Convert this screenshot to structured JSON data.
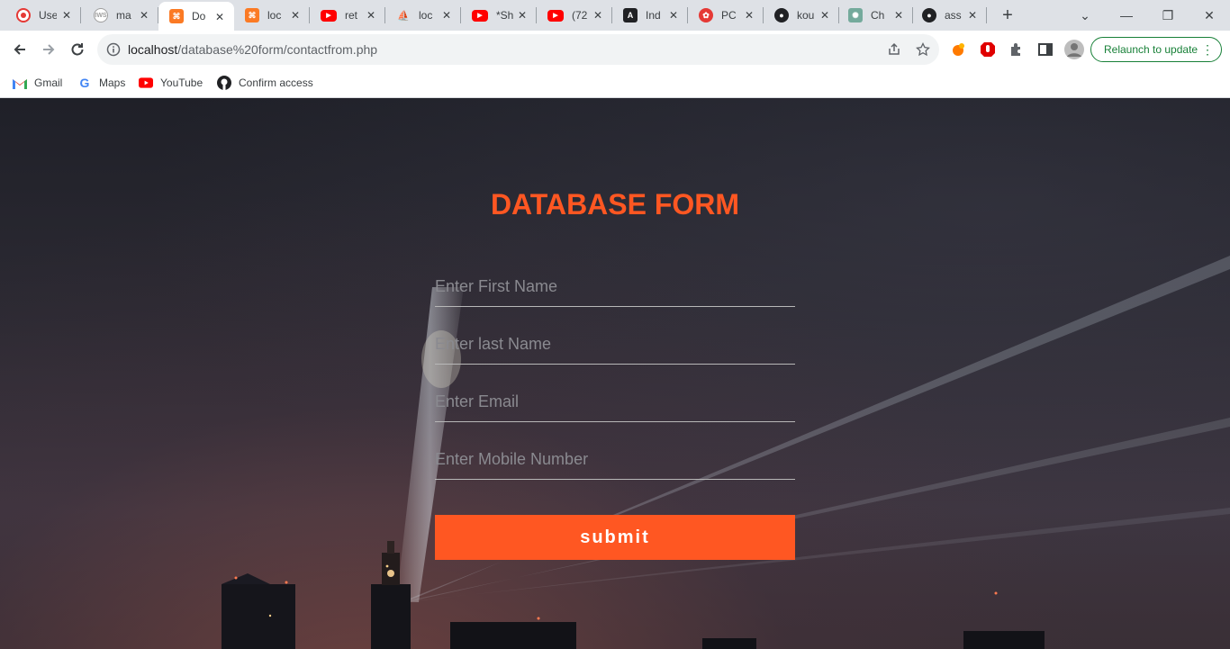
{
  "tabs": [
    {
      "title": "Use",
      "favicon": "record-icon",
      "color": "#e53935"
    },
    {
      "title": "ma",
      "favicon": "globe-icon",
      "color": "#9e9e9e"
    },
    {
      "title": "Do",
      "favicon": "xampp-icon",
      "color": "#fb7a24",
      "active": true
    },
    {
      "title": "loc",
      "favicon": "xampp-icon",
      "color": "#fb7a24"
    },
    {
      "title": "ret",
      "favicon": "youtube-icon",
      "color": "#ff0000"
    },
    {
      "title": "loc",
      "favicon": "phpmyadmin-icon",
      "color": "#f29111"
    },
    {
      "title": "*Sh",
      "favicon": "youtube-icon",
      "color": "#ff0000"
    },
    {
      "title": "(72",
      "favicon": "youtube-icon",
      "color": "#ff0000"
    },
    {
      "title": "Ind",
      "favicon": "angular-icon",
      "color": "#202124"
    },
    {
      "title": "PC",
      "favicon": "pc-icon",
      "color": "#e53935"
    },
    {
      "title": "kou",
      "favicon": "github-icon",
      "color": "#202124"
    },
    {
      "title": "Ch",
      "favicon": "chatgpt-icon",
      "color": "#74aa9c"
    },
    {
      "title": "ass",
      "favicon": "github-icon",
      "color": "#202124"
    }
  ],
  "address_bar": {
    "host": "localhost",
    "path": "/database%20form/contactfrom.php"
  },
  "relaunch_label": "Relaunch to update",
  "bookmarks": [
    {
      "label": "Gmail",
      "icon": "gmail-icon"
    },
    {
      "label": "Maps",
      "icon": "google-icon"
    },
    {
      "label": "YouTube",
      "icon": "youtube-icon"
    },
    {
      "label": "Confirm access",
      "icon": "github-icon"
    }
  ],
  "form": {
    "title": "DATABASE FORM",
    "first_name_placeholder": "Enter First Name",
    "last_name_placeholder": "Enter last Name",
    "email_placeholder": "Enter Email",
    "mobile_placeholder": "Enter Mobile Number",
    "submit_label": "submit"
  },
  "colors": {
    "accent": "#ff5722",
    "relaunch": "#188038"
  }
}
